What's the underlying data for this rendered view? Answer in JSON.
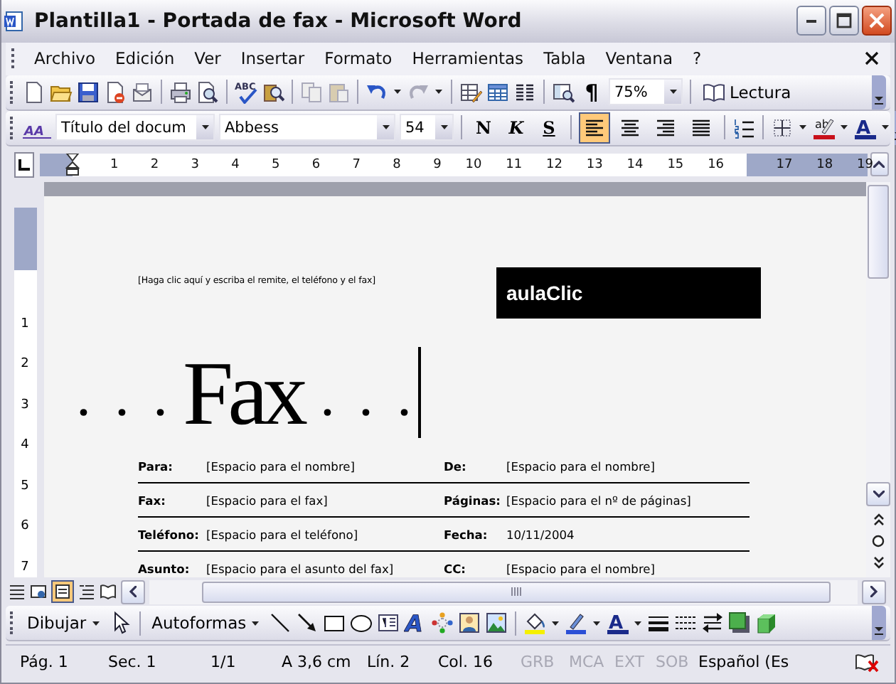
{
  "window": {
    "title": "Plantilla1 - Portada de fax - Microsoft Word"
  },
  "menu": {
    "items": [
      "Archivo",
      "Edición",
      "Ver",
      "Insertar",
      "Formato",
      "Herramientas",
      "Tabla",
      "Ventana",
      "?"
    ]
  },
  "standard_toolbar": {
    "spelling_label": "ABC",
    "pilcrow": "¶",
    "zoom": "75%",
    "reading": "Lectura"
  },
  "format_toolbar": {
    "styles_label": "AA",
    "style": "Título del docum",
    "font": "Abbess",
    "size": "54",
    "bold": "N",
    "italic": "K",
    "underline": "S",
    "alignments": [
      {
        "kind": "left",
        "selected": true
      },
      {
        "kind": "center",
        "selected": false
      },
      {
        "kind": "right",
        "selected": false
      },
      {
        "kind": "justify",
        "selected": false
      }
    ],
    "highlight_label": "ab",
    "font_color_label": "A"
  },
  "ruler": {
    "horizontal": [
      "1",
      "2",
      "3",
      "4",
      "5",
      "6",
      "7",
      "8",
      "9",
      "10",
      "11",
      "12",
      "13",
      "14",
      "15",
      "16",
      "17",
      "18",
      "19"
    ],
    "vertical": [
      "1",
      "2",
      "3",
      "4",
      "5",
      "6",
      "7"
    ]
  },
  "document": {
    "return_address": "[Haga clic aquí y escriba el remite, el teléfono y el fax]",
    "logo": "aulaClic",
    "heading_dots_left": ". . .",
    "heading": "Fax",
    "heading_dots_right": ". . .",
    "rows": [
      {
        "left": {
          "label": "Para:",
          "value": "[Espacio para el nombre]"
        },
        "right": {
          "label": "De:",
          "value": "[Espacio para el nombre]"
        }
      },
      {
        "left": {
          "label": "Fax:",
          "value": "[Espacio para el fax]"
        },
        "right": {
          "label": "Páginas:",
          "value": "[Espacio para el nº de páginas]"
        }
      },
      {
        "left": {
          "label": "Teléfono:",
          "value": "[Espacio para el teléfono]"
        },
        "right": {
          "label": "Fecha:",
          "value": "10/11/2004"
        }
      },
      {
        "left": {
          "label": "Asunto:",
          "value": "[Espacio para el asunto del fax]"
        },
        "right": {
          "label": "CC:",
          "value": "[Espacio para el nombre]"
        }
      }
    ]
  },
  "drawing_toolbar": {
    "draw": "Dibujar",
    "autoshapes": "Autoformas",
    "wordart_label": "A",
    "font_color_label": "A"
  },
  "status_bar": {
    "fields": [
      {
        "text": "Pág. 1",
        "disabled": false
      },
      {
        "text": "Sec. 1",
        "disabled": false
      },
      {
        "text": "1/1",
        "disabled": false
      },
      {
        "text": "A 3,6 cm",
        "disabled": false
      },
      {
        "text": "Lín. 2",
        "disabled": false
      },
      {
        "text": "Col. 16",
        "disabled": false
      },
      {
        "text": "GRB",
        "disabled": true
      },
      {
        "text": "MCA",
        "disabled": true
      },
      {
        "text": "EXT",
        "disabled": true
      },
      {
        "text": "SOB",
        "disabled": true
      },
      {
        "text": "Español (Es",
        "disabled": false
      }
    ]
  }
}
